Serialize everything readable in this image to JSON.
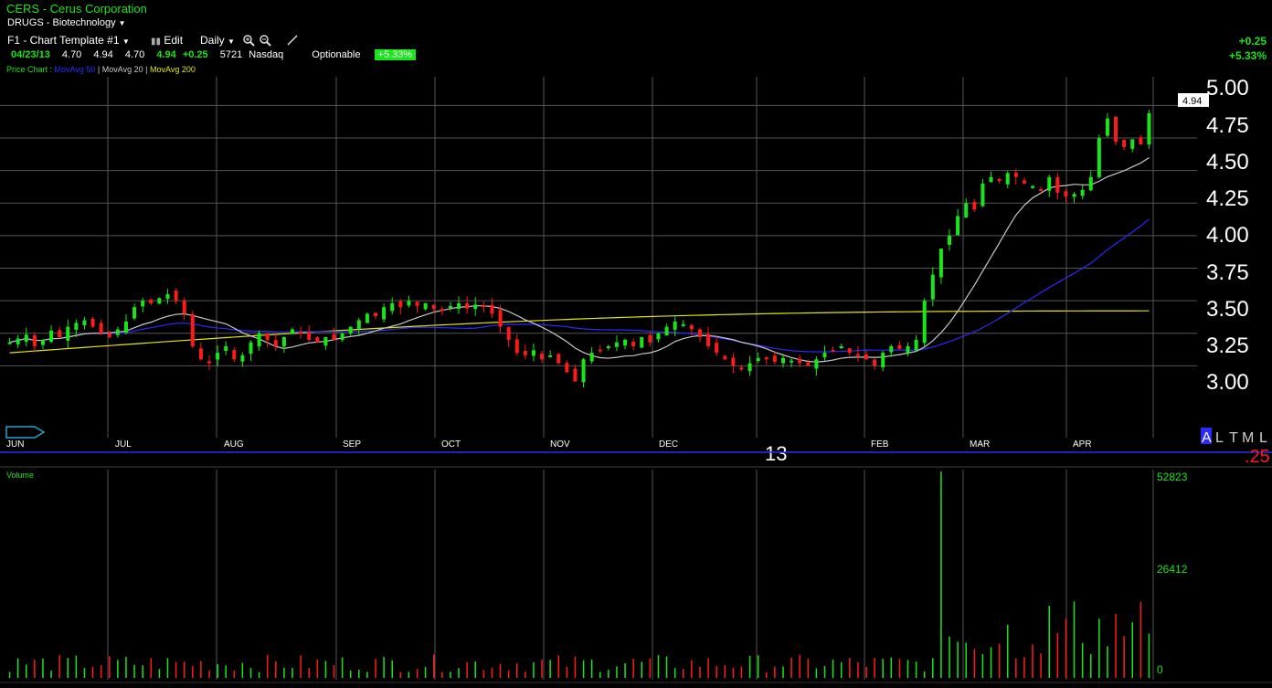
{
  "header": {
    "symbol_line": "CERS - Cerus Corporation",
    "industry": "DRUGS - Biotechnology",
    "template": "F1 - Chart Template #1",
    "edit_label": "Edit",
    "period": "Daily",
    "quote": {
      "date": "04/23/13",
      "open": "4.70",
      "high": "4.94",
      "low": "4.70",
      "last": "4.94",
      "change": "+0.25",
      "volume": "5721",
      "exchange": "Nasdaq",
      "optionable": "Optionable",
      "pct_change": "+5.33%"
    },
    "right_change": "+0.25",
    "right_pct": "+5.33%"
  },
  "legend": {
    "price_chart": "Price Chart :",
    "ma50": "MovAvg 50",
    "ma20": "MovAvg 20",
    "ma200": "MovAvg 200"
  },
  "price_axis": {
    "labels": [
      "5.00",
      "4.75",
      "4.50",
      "4.25",
      "4.00",
      "3.75",
      "3.50",
      "3.25",
      "3.00"
    ],
    "current_price_tag": "4.94"
  },
  "time_axis": {
    "months": [
      "JUN",
      "JUL",
      "AUG",
      "SEP",
      "OCT",
      "NOV",
      "DEC",
      "FEB",
      "MAR",
      "APR"
    ],
    "year_label": "13",
    "range_buttons": [
      "A",
      "L",
      "T",
      "M",
      "L"
    ],
    "right_value": ".25"
  },
  "volume_panel": {
    "title": "Volume",
    "labels": [
      "52823",
      "26412",
      "0"
    ]
  },
  "colors": {
    "up": "#19e619",
    "down": "#ff1a1a",
    "ma50": "#2a2aff",
    "ma20": "#c8c8c8",
    "ma200": "#e6e600",
    "grid": "#555555",
    "accent": "#19e619"
  },
  "chart_data": {
    "type": "candlestick",
    "title": "CERS - Cerus Corporation",
    "ylim": [
      2.75,
      5.15
    ],
    "y_ticks": [
      3.0,
      3.25,
      3.5,
      3.75,
      4.0,
      4.25,
      4.5,
      4.75,
      5.0
    ],
    "x_months": [
      "JUN",
      "JUL",
      "AUG",
      "SEP",
      "OCT",
      "NOV",
      "DEC",
      "FEB",
      "MAR",
      "APR"
    ],
    "closes_approx": [
      3.18,
      3.21,
      3.24,
      3.15,
      3.2,
      3.27,
      3.22,
      3.3,
      3.33,
      3.35,
      3.3,
      3.25,
      3.22,
      3.28,
      3.34,
      3.45,
      3.5,
      3.48,
      3.52,
      3.55,
      3.5,
      3.4,
      3.15,
      3.05,
      3.02,
      3.1,
      3.15,
      3.05,
      3.08,
      3.18,
      3.25,
      3.2,
      3.15,
      3.22,
      3.28,
      3.25,
      3.2,
      3.18,
      3.22,
      3.2,
      3.25,
      3.3,
      3.35,
      3.4,
      3.38,
      3.45,
      3.48,
      3.45,
      3.5,
      3.46,
      3.48,
      3.44,
      3.42,
      3.46,
      3.48,
      3.44,
      3.47,
      3.45,
      3.4,
      3.3,
      3.2,
      3.1,
      3.08,
      3.12,
      3.05,
      3.08,
      3.02,
      2.95,
      2.88,
      3.05,
      3.1,
      3.12,
      3.15,
      3.18,
      3.2,
      3.15,
      3.22,
      3.18,
      3.25,
      3.3,
      3.34,
      3.32,
      3.28,
      3.22,
      3.15,
      3.1,
      3.05,
      3.0,
      2.98,
      3.02,
      3.06,
      3.05,
      3.03,
      3.06,
      3.04,
      3.02,
      3.0,
      3.05,
      3.1,
      3.12,
      3.15,
      3.1,
      3.08,
      3.05,
      3.0,
      3.1,
      3.15,
      3.13,
      3.15,
      3.2,
      3.5,
      3.7,
      3.9,
      4.0,
      4.15,
      4.25,
      4.2,
      4.4,
      4.45,
      4.42,
      4.48,
      4.45,
      4.4,
      4.38,
      4.35,
      4.45,
      4.33,
      4.3,
      4.32,
      4.35,
      4.45,
      4.75,
      4.9,
      4.72,
      4.68,
      4.74,
      4.7,
      4.94
    ],
    "ma200_last": 3.42,
    "ma50_last": 4.07,
    "ma20_last": 4.56,
    "volume_ylim": [
      0,
      52823
    ],
    "volume_ticks": [
      0,
      26412,
      52823
    ]
  }
}
